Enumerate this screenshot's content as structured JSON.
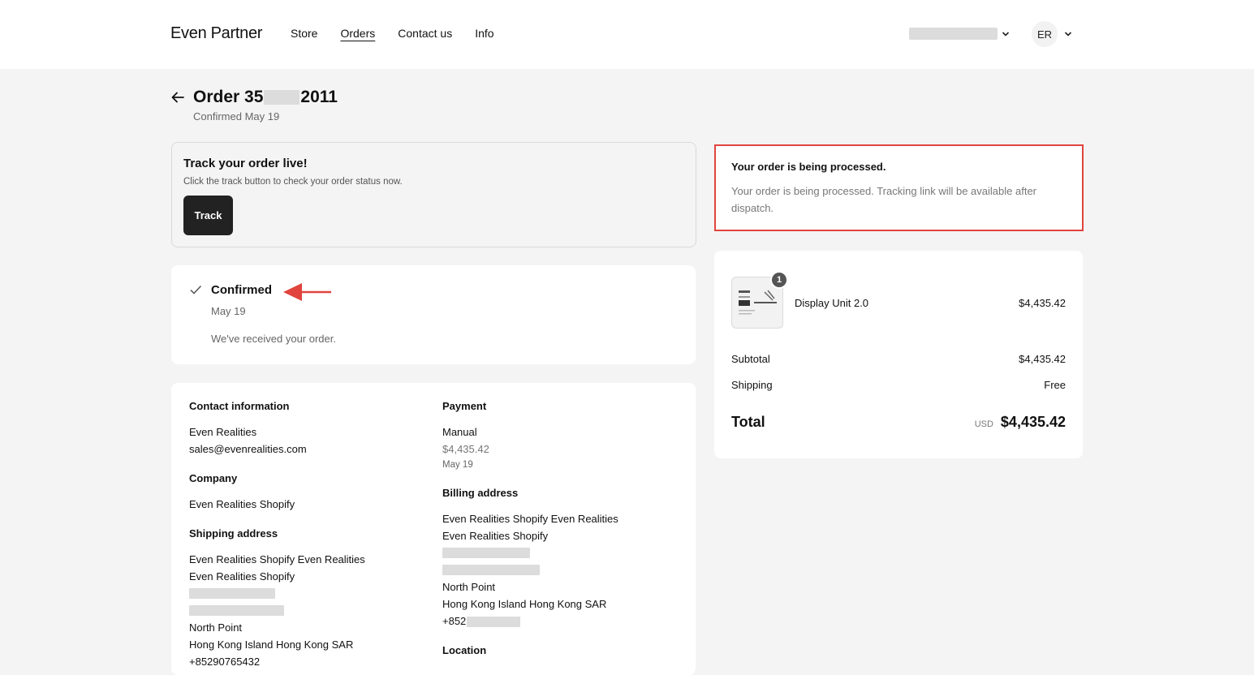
{
  "header": {
    "brand": "Even Partner",
    "nav": [
      "Store",
      "Orders",
      "Contact us",
      "Info"
    ],
    "active_nav": "Orders",
    "avatar_initials": "ER"
  },
  "order": {
    "title_prefix": "Order 35",
    "title_suffix": "2011",
    "subtitle": "Confirmed May 19"
  },
  "track": {
    "title": "Track your order live!",
    "description": "Click the track button to check your order status now.",
    "button_label": "Track"
  },
  "status": {
    "title": "Confirmed",
    "date": "May 19",
    "message": "We've received your order."
  },
  "details": {
    "contact": {
      "heading": "Contact information",
      "name": "Even Realities",
      "email": "sales@evenrealities.com"
    },
    "company": {
      "heading": "Company",
      "name": "Even Realities Shopify"
    },
    "shipping": {
      "heading": "Shipping address",
      "line1": "Even Realities Shopify Even Realities",
      "line2": "Even Realities Shopify",
      "line3": "North Point",
      "line4": "Hong Kong Island Hong Kong SAR",
      "phone": "+85290765432"
    },
    "payment": {
      "heading": "Payment",
      "method": "Manual",
      "amount": "$4,435.42",
      "date": "May 19"
    },
    "billing": {
      "heading": "Billing address",
      "line1": "Even Realities Shopify Even Realities",
      "line2": "Even Realities Shopify",
      "line3": "North Point",
      "line4": "Hong Kong Island Hong Kong SAR",
      "phone_prefix": "+852"
    },
    "location": {
      "heading": "Location"
    }
  },
  "processing": {
    "title": "Your order is being processed.",
    "message": "Your order is being processed. Tracking link will be available after dispatch."
  },
  "summary": {
    "item": {
      "name": "Display Unit 2.0",
      "price": "$4,435.42",
      "quantity": "1"
    },
    "subtotal_label": "Subtotal",
    "subtotal": "$4,435.42",
    "shipping_label": "Shipping",
    "shipping": "Free",
    "total_label": "Total",
    "currency": "USD",
    "total": "$4,435.42"
  },
  "colors": {
    "highlight": "#e0443c",
    "button": "#222222",
    "background": "#f4f4f4"
  }
}
